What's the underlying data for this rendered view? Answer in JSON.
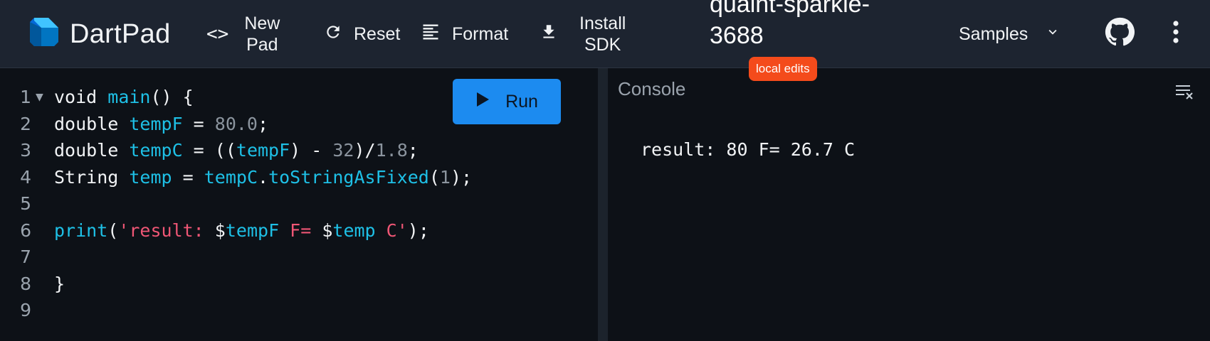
{
  "appbar": {
    "logo_text": "DartPad",
    "new_pad_line1": "New",
    "new_pad_line2": "Pad",
    "new_pad_glyph": "<>",
    "reset_label": "Reset",
    "format_label": "Format",
    "install_line1": "Install",
    "install_line2": "SDK",
    "pad_name_line1": "quaint-sparkle-",
    "pad_name_line2": "3688",
    "badge": "local edits",
    "samples_label": "Samples",
    "icons": {
      "logo": "dart-logo-icon",
      "new_pad": "code-brackets-icon",
      "reset": "refresh-icon",
      "format": "format-lines-icon",
      "install": "download-icon",
      "samples": "chevron-down-icon",
      "github": "github-icon",
      "menu": "more-vert-icon"
    }
  },
  "editor": {
    "run_label": "Run",
    "run_icon": "play-icon",
    "lines": [
      {
        "num": "1",
        "fold": "▼",
        "tokens": [
          [
            "kw",
            "void "
          ],
          [
            "id",
            "main"
          ],
          [
            "kw",
            "() {"
          ]
        ]
      },
      {
        "num": "2",
        "fold": "",
        "tokens": [
          [
            "kw",
            "double "
          ],
          [
            "id",
            "tempF"
          ],
          [
            "kw",
            " = "
          ],
          [
            "num",
            "80.0"
          ],
          [
            "kw",
            ";"
          ]
        ]
      },
      {
        "num": "3",
        "fold": "",
        "tokens": [
          [
            "kw",
            "double "
          ],
          [
            "id",
            "tempC"
          ],
          [
            "kw",
            " = (("
          ],
          [
            "id",
            "tempF"
          ],
          [
            "kw",
            ") - "
          ],
          [
            "num",
            "32"
          ],
          [
            "kw",
            ")/"
          ],
          [
            "num",
            "1.8"
          ],
          [
            "kw",
            ";"
          ]
        ]
      },
      {
        "num": "4",
        "fold": "",
        "tokens": [
          [
            "kw",
            "String "
          ],
          [
            "id",
            "temp"
          ],
          [
            "kw",
            " = "
          ],
          [
            "id",
            "tempC"
          ],
          [
            "kw",
            "."
          ],
          [
            "id",
            "toStringAsFixed"
          ],
          [
            "kw",
            "("
          ],
          [
            "num",
            "1"
          ],
          [
            "kw",
            ");"
          ]
        ]
      },
      {
        "num": "5",
        "fold": "",
        "tokens": []
      },
      {
        "num": "6",
        "fold": "",
        "tokens": [
          [
            "id",
            "print"
          ],
          [
            "kw",
            "("
          ],
          [
            "str",
            "'result: "
          ],
          [
            "kw",
            "$"
          ],
          [
            "id",
            "tempF"
          ],
          [
            "str",
            " F= "
          ],
          [
            "kw",
            "$"
          ],
          [
            "id",
            "temp"
          ],
          [
            "str",
            " C'"
          ],
          [
            "kw",
            ");"
          ]
        ]
      },
      {
        "num": "7",
        "fold": "",
        "tokens": []
      },
      {
        "num": "8",
        "fold": "",
        "tokens": [
          [
            "kw",
            "}"
          ]
        ]
      },
      {
        "num": "9",
        "fold": "",
        "tokens": []
      }
    ]
  },
  "console": {
    "title": "Console",
    "clear_icon": "clear-all-icon",
    "output": "result: 80 F= 26.7 C"
  },
  "colors": {
    "appbar_bg": "#1d2430",
    "editor_bg": "#0d1117",
    "identifier": "#1ec0e6",
    "number": "#8b949e",
    "string": "#ef5675",
    "run_button": "#1c8bf0",
    "badge": "#f44b1b"
  }
}
